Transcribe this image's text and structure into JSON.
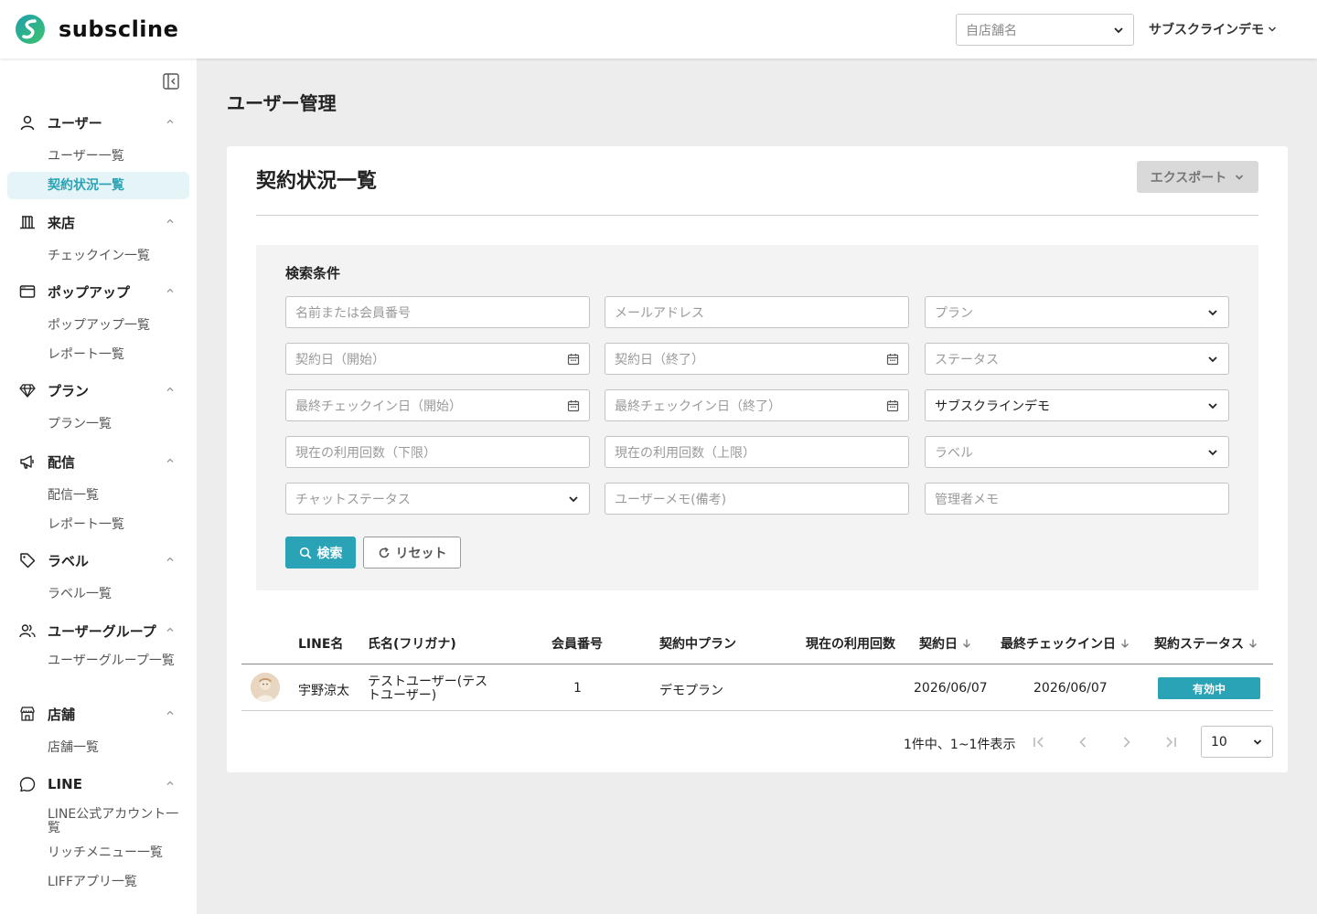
{
  "header": {
    "brand": "subscline",
    "store_select_placeholder": "自店舗名",
    "account_name": "サブスクラインデモ"
  },
  "sidebar": {
    "groups": [
      {
        "label": "ユーザー",
        "icon": "user-icon",
        "items": [
          "ユーザー一覧",
          "契約状況一覧"
        ]
      },
      {
        "label": "来店",
        "icon": "building-icon",
        "items": [
          "チェックイン一覧"
        ]
      },
      {
        "label": "ポップアップ",
        "icon": "window-icon",
        "items": [
          "ポップアップ一覧",
          "レポート一覧"
        ]
      },
      {
        "label": "プラン",
        "icon": "diamond-icon",
        "items": [
          "プラン一覧"
        ]
      },
      {
        "label": "配信",
        "icon": "megaphone-icon",
        "items": [
          "配信一覧",
          "レポート一覧"
        ]
      },
      {
        "label": "ラベル",
        "icon": "tag-icon",
        "items": [
          "ラベル一覧"
        ]
      },
      {
        "label": "ユーザーグループ",
        "icon": "users-icon",
        "items": [
          "ユーザーグループ一覧"
        ]
      },
      {
        "label": "店舗",
        "icon": "store-icon",
        "items": [
          "店舗一覧"
        ]
      },
      {
        "label": "LINE",
        "icon": "chat-icon",
        "items": [
          "LINE公式アカウント一覧",
          "リッチメニュー一覧",
          "LIFFアプリ一覧"
        ]
      }
    ],
    "active_item": "契約状況一覧"
  },
  "main": {
    "page_title": "ユーザー管理",
    "card_title": "契約状況一覧",
    "export_label": "エクスポート",
    "search": {
      "heading": "検索条件",
      "fields": {
        "name": "名前または会員番号",
        "email": "メールアドレス",
        "plan": "プラン",
        "contract_start": "契約日（開始）",
        "contract_end": "契約日（終了）",
        "status": "ステータス",
        "checkin_start": "最終チェックイン日（開始）",
        "checkin_end": "最終チェックイン日（終了）",
        "store": "サブスクラインデモ",
        "usage_min": "現在の利用回数（下限）",
        "usage_max": "現在の利用回数（上限）",
        "label": "ラベル",
        "chat_status": "チャットステータス",
        "user_memo": "ユーザーメモ(備考)",
        "admin_memo": "管理者メモ"
      },
      "search_label": "検索",
      "reset_label": "リセット"
    },
    "table": {
      "columns": {
        "line_name": "LINE名",
        "full_name": "氏名(フリガナ)",
        "member_no": "会員番号",
        "plan": "契約中プラン",
        "usage": "現在の利用回数",
        "contract_date": "契約日",
        "last_checkin": "最終チェックイン日",
        "status": "契約ステータス"
      },
      "rows": [
        {
          "line_name": "宇野涼太",
          "full_name_line1": "テストユーザー(テス",
          "full_name_line2": "トユーザー)",
          "member_no": "1",
          "plan": "デモプラン",
          "usage": "",
          "contract_date": "2026/06/07",
          "last_checkin": "2026/06/07",
          "status": "有効中"
        }
      ]
    },
    "pagination": {
      "summary": "1件中、1~1件表示",
      "page_size": "10"
    }
  },
  "colors": {
    "accent": "#2aa3b7",
    "active_bg": "#e5f4f6"
  }
}
